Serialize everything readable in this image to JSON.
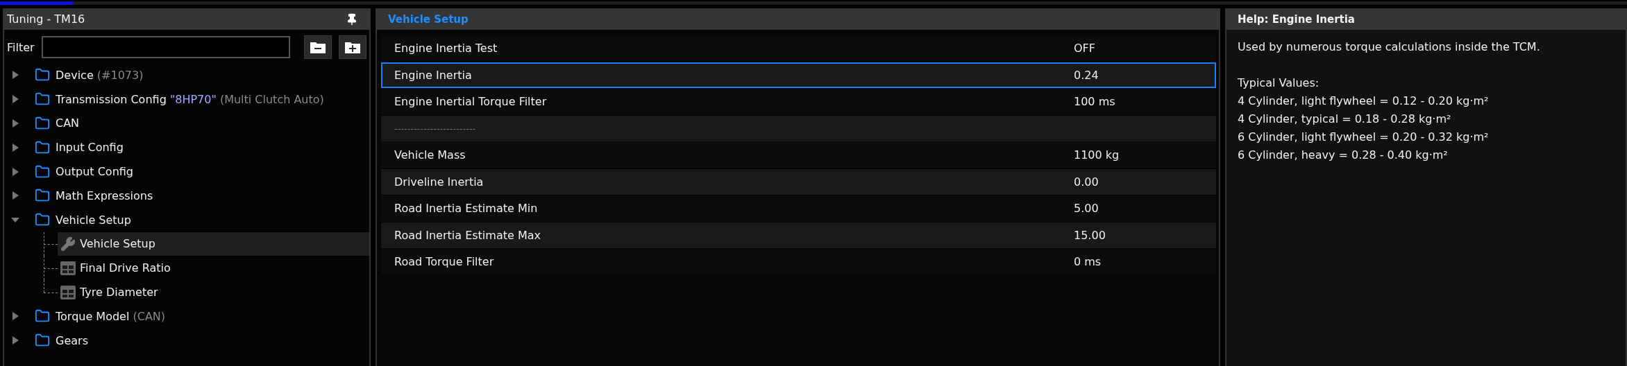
{
  "top_strip": {
    "level": 0.045
  },
  "tuning_panel": {
    "title": "Tuning - TM16",
    "filter": {
      "label": "Filter"
    },
    "tree": [
      {
        "kind": "folder",
        "label": "Device",
        "note": "(#1073)",
        "expanded": false,
        "selected": false
      },
      {
        "kind": "folder",
        "label": "Transmission Config",
        "quoted": "\"8HP70\"",
        "note": "(Multi Clutch Auto)",
        "expanded": false,
        "selected": false
      },
      {
        "kind": "folder",
        "label": "CAN",
        "expanded": false,
        "selected": false
      },
      {
        "kind": "folder",
        "label": "Input Config",
        "expanded": false,
        "selected": false
      },
      {
        "kind": "folder",
        "label": "Output Config",
        "expanded": false,
        "selected": false
      },
      {
        "kind": "folder",
        "label": "Math Expressions",
        "expanded": false,
        "selected": false
      },
      {
        "kind": "folder",
        "label": "Vehicle Setup",
        "expanded": true,
        "selected": false,
        "children": [
          {
            "kind": "setting",
            "label": "Vehicle Setup",
            "selected": true
          },
          {
            "kind": "table",
            "label": "Final Drive Ratio",
            "selected": false
          },
          {
            "kind": "table",
            "label": "Tyre Diameter",
            "selected": false
          }
        ]
      },
      {
        "kind": "folder",
        "label": "Torque Model",
        "note": "(CAN)",
        "expanded": false,
        "selected": false
      },
      {
        "kind": "folder",
        "label": "Gears",
        "expanded": false,
        "selected": false
      }
    ]
  },
  "settings_panel": {
    "title": "Vehicle Setup",
    "rows": [
      {
        "kind": "setting",
        "name": "Engine Inertia Test",
        "value": "OFF",
        "selected": false
      },
      {
        "kind": "setting",
        "name": "Engine Inertia",
        "value": "0.24",
        "selected": true
      },
      {
        "kind": "setting",
        "name": "Engine Inertial Torque Filter",
        "value": "100 ms",
        "selected": false
      },
      {
        "kind": "separator",
        "name": "-------------------------"
      },
      {
        "kind": "setting",
        "name": "Vehicle Mass",
        "value": "1100 kg",
        "selected": false
      },
      {
        "kind": "setting",
        "name": "Driveline Inertia",
        "value": "0.00",
        "selected": false
      },
      {
        "kind": "setting",
        "name": "Road Inertia Estimate Min",
        "value": "5.00",
        "selected": false
      },
      {
        "kind": "setting",
        "name": "Road Inertia Estimate Max",
        "value": "15.00",
        "selected": false
      },
      {
        "kind": "setting",
        "name": "Road Torque Filter",
        "value": "0 ms",
        "selected": false
      }
    ]
  },
  "help_panel": {
    "title": "Help: Engine Inertia",
    "paragraphs": [
      {
        "lines": [
          "Used by numerous torque calculations inside the TCM."
        ]
      },
      {
        "lines": [
          "Typical Values:",
          "4 Cylinder, light flywheel = 0.12 - 0.20 kg·m²",
          "4 Cylinder, typical = 0.18 - 0.28 kg·m²",
          "6 Cylinder, light flywheel = 0.20 - 0.32 kg·m²",
          "6 Cylinder, heavy = 0.28 - 0.40 kg·m²"
        ]
      }
    ]
  }
}
